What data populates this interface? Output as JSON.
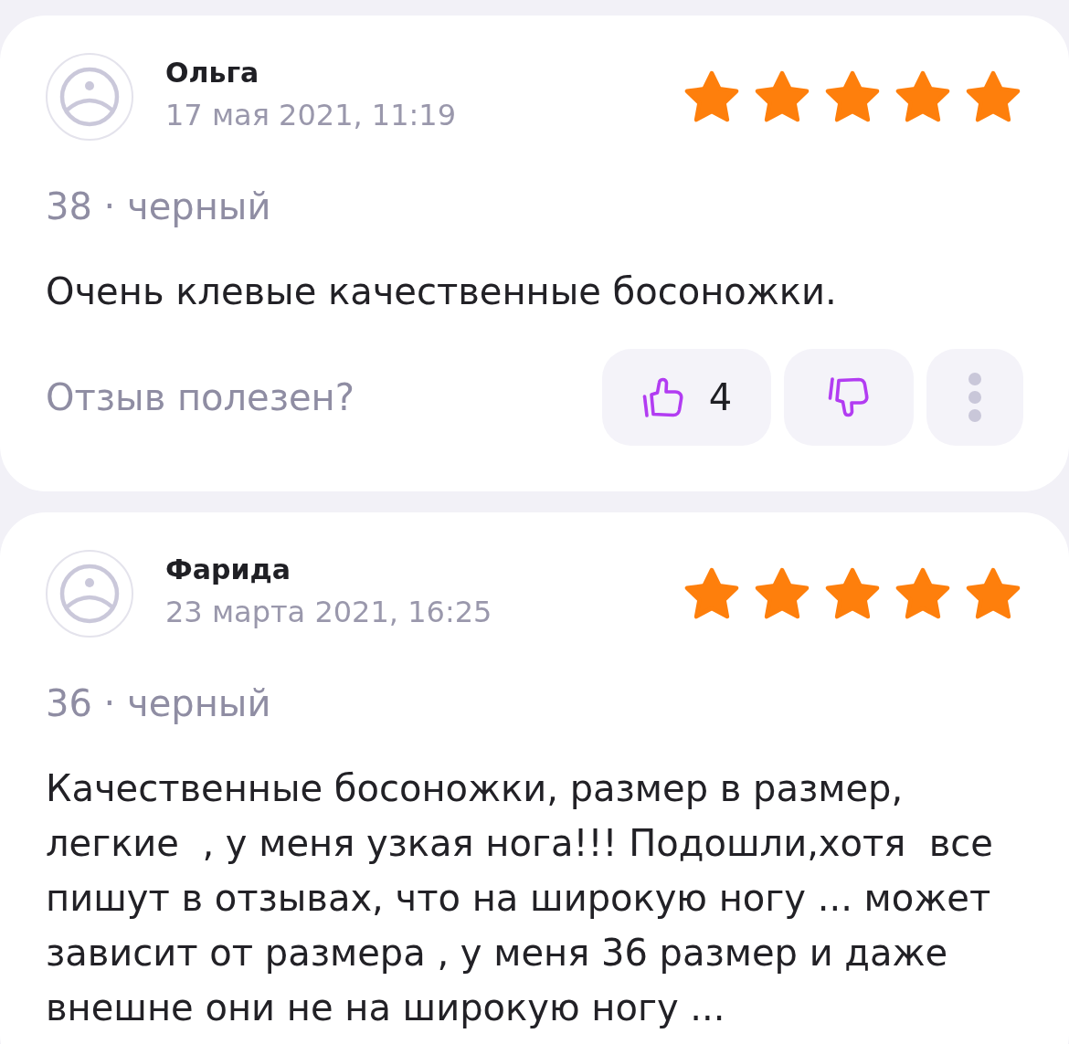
{
  "reviews": [
    {
      "author": "Ольга",
      "date": "17 мая 2021, 11:19",
      "stars": 5,
      "variant": "38 · черный",
      "text": "Очень клевые качественные босоножки.",
      "helpful": {
        "question": "Отзыв полезен?",
        "likes": "4"
      }
    },
    {
      "author": "Фарида",
      "date": "23 марта 2021, 16:25",
      "stars": 5,
      "variant": "36 · черный",
      "text": "Качественные босоножки, размер в размер, легкие  , у меня узкая нога!!! Подошли,хотя  все пишут в отзывах, что на широкую ногу ... может зависит от размера , у меня 36 размер и даже внешне они не на широкую ногу ..."
    }
  ]
}
